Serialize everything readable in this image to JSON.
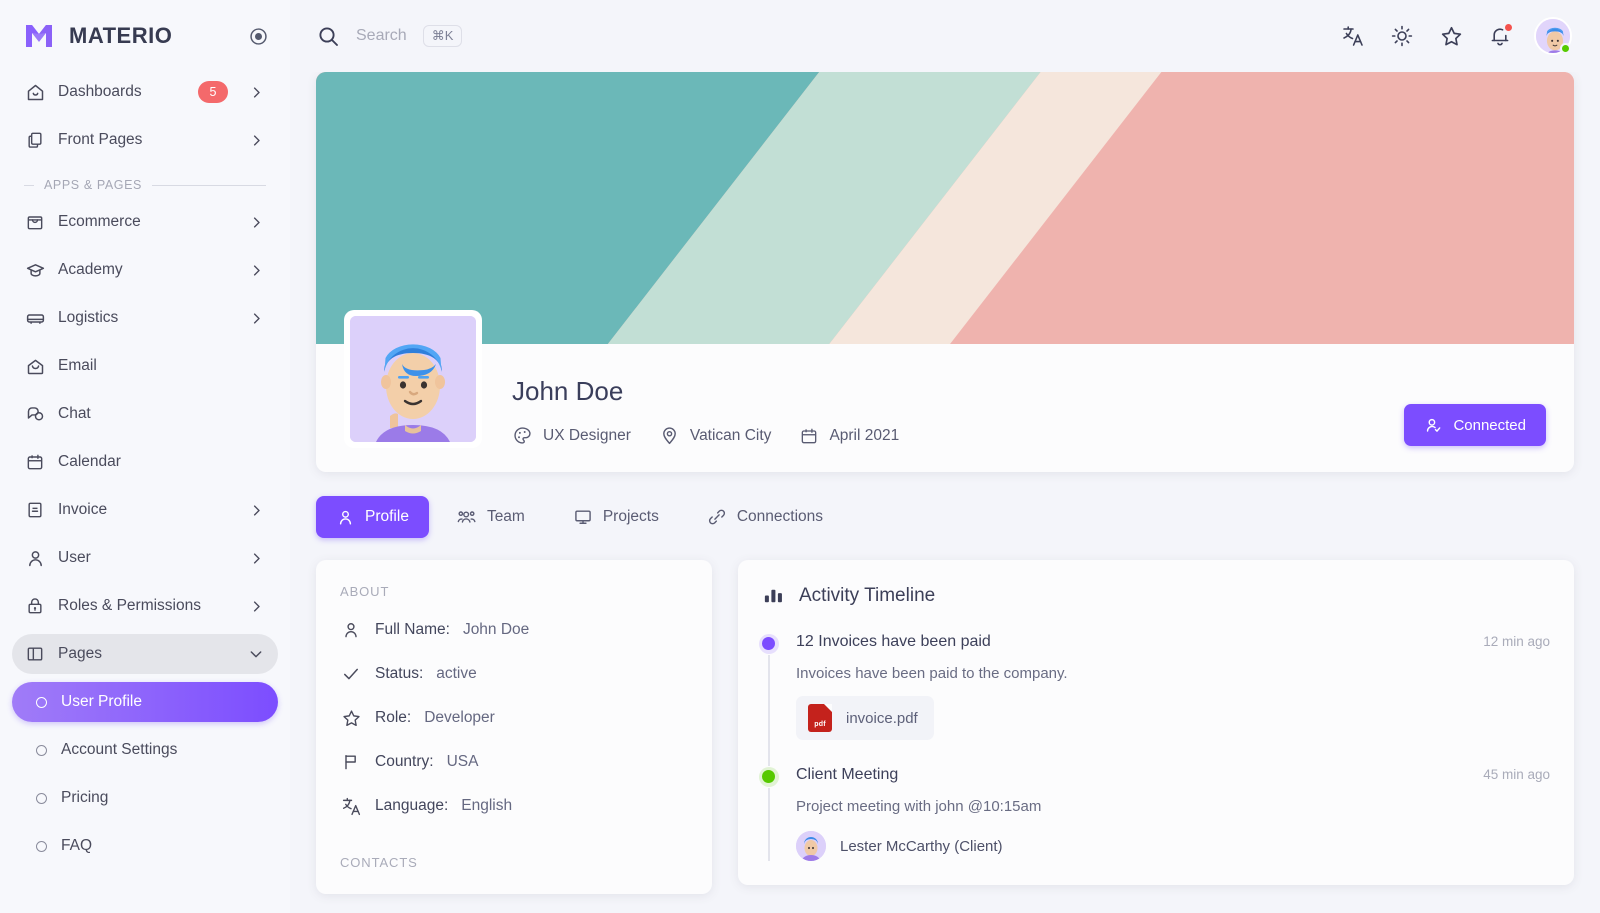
{
  "brand": {
    "name": "MATERIO",
    "logo_icon": "materio-m-logo",
    "pin_icon": "radio-circle-icon"
  },
  "topbar": {
    "search_icon": "search-icon",
    "search_placeholder": "Search",
    "search_shortcut": "⌘K",
    "icons": [
      {
        "name": "translate-icon",
        "label": "文A"
      },
      {
        "name": "brightness-icon",
        "label": "sun"
      },
      {
        "name": "star-icon",
        "label": "star"
      },
      {
        "name": "notifications-icon",
        "label": "bell"
      }
    ],
    "avatar_name": "user-avatar"
  },
  "sidebar": {
    "top_items": [
      {
        "label": "Dashboards",
        "icon": "home-icon",
        "badge": "5",
        "chevron": "chevron-right"
      },
      {
        "label": "Front Pages",
        "icon": "copy-icon",
        "badge": "",
        "chevron": "chevron-right"
      }
    ],
    "section_label": "APPS & PAGES",
    "items": [
      {
        "label": "Ecommerce",
        "icon": "shopping-bag-icon",
        "chevron": "chevron-right"
      },
      {
        "label": "Academy",
        "icon": "graduation-cap-icon",
        "chevron": "chevron-right"
      },
      {
        "label": "Logistics",
        "icon": "truck-icon",
        "chevron": "chevron-right"
      },
      {
        "label": "Email",
        "icon": "mail-icon",
        "chevron": ""
      },
      {
        "label": "Chat",
        "icon": "chat-bubbles-icon",
        "chevron": ""
      },
      {
        "label": "Calendar",
        "icon": "calendar-icon",
        "chevron": ""
      },
      {
        "label": "Invoice",
        "icon": "invoice-icon",
        "chevron": "chevron-right"
      },
      {
        "label": "User",
        "icon": "user-icon",
        "chevron": "chevron-right"
      },
      {
        "label": "Roles & Permissions",
        "icon": "lock-icon",
        "chevron": "chevron-right"
      },
      {
        "label": "Pages",
        "icon": "layout-panel-icon",
        "chevron": "chevron-down",
        "open": true
      }
    ],
    "sub_items": [
      {
        "label": "User Profile",
        "active": true
      },
      {
        "label": "Account Settings",
        "active": false
      },
      {
        "label": "Pricing",
        "active": false
      },
      {
        "label": "FAQ",
        "active": false
      }
    ]
  },
  "profile": {
    "banner_colors": [
      "#6BB8B8",
      "#C2DFD5",
      "#F5E6DC",
      "#EFB3AE"
    ],
    "avatar_name": "profile-avatar",
    "name": "John Doe",
    "meta": [
      {
        "icon": "palette-icon",
        "text": "UX Designer"
      },
      {
        "icon": "map-pin-icon",
        "text": "Vatican City"
      },
      {
        "icon": "calendar-icon",
        "text": "April 2021"
      }
    ],
    "connect_button": {
      "label": "Connected",
      "icon": "user-check-icon",
      "color": "#7C4DFF"
    }
  },
  "tabs": [
    {
      "label": "Profile",
      "icon": "user-icon",
      "active": true
    },
    {
      "label": "Team",
      "icon": "users-icon",
      "active": false
    },
    {
      "label": "Projects",
      "icon": "monitor-icon",
      "active": false
    },
    {
      "label": "Connections",
      "icon": "link-icon",
      "active": false
    }
  ],
  "about": {
    "title": "ABOUT",
    "rows": [
      {
        "icon": "user-icon",
        "key": "Full Name:",
        "value": "John Doe"
      },
      {
        "icon": "check-icon",
        "key": "Status:",
        "value": "active"
      },
      {
        "icon": "star-icon",
        "key": "Role:",
        "value": "Developer"
      },
      {
        "icon": "flag-icon",
        "key": "Country:",
        "value": "USA"
      },
      {
        "icon": "translate-icon",
        "key": "Language:",
        "value": "English"
      }
    ],
    "contacts_title": "CONTACTS"
  },
  "activity": {
    "icon": "bar-chart-icon",
    "title": "Activity Timeline",
    "items": [
      {
        "dot_color": "#7C4DFF",
        "title": "12 Invoices have been paid",
        "time": "12 min ago",
        "desc": "Invoices have been paid to the company.",
        "file": {
          "name": "invoice.pdf",
          "type": "pdf"
        }
      },
      {
        "dot_color": "#56CA00",
        "title": "Client Meeting",
        "time": "45 min ago",
        "desc": "Project meeting with john @10:15am",
        "person": "Lester McCarthy (Client)"
      }
    ]
  }
}
